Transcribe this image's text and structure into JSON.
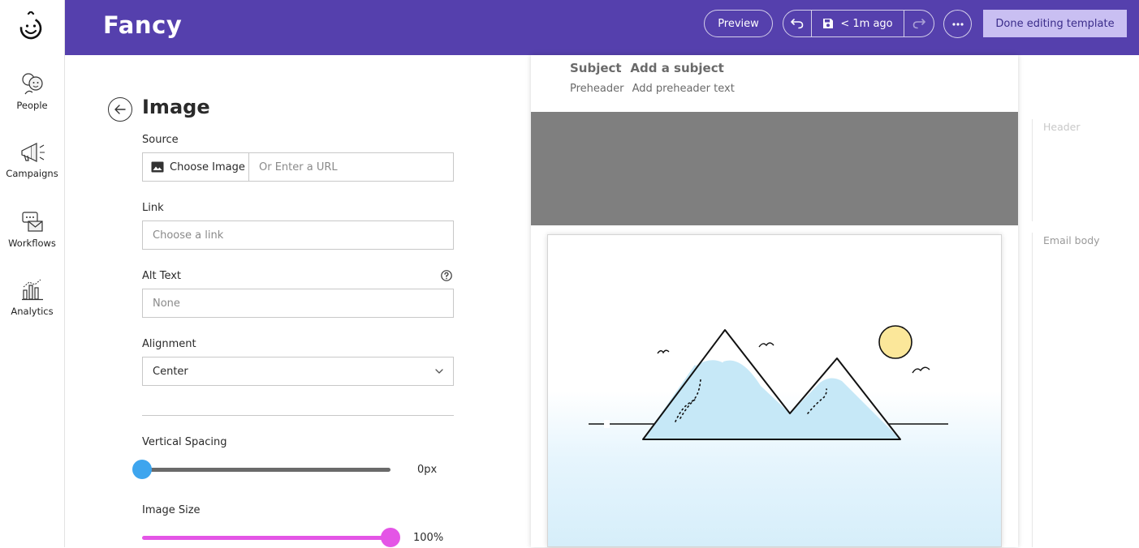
{
  "app": {
    "title": "Fancy"
  },
  "nav": [
    {
      "label": "People",
      "icon": "people-icon"
    },
    {
      "label": "Campaigns",
      "icon": "megaphone-icon"
    },
    {
      "label": "Workflows",
      "icon": "workflow-icon"
    },
    {
      "label": "Analytics",
      "icon": "analytics-icon"
    }
  ],
  "toolbar": {
    "preview_label": "Preview",
    "save_status": "< 1m ago",
    "done_label": "Done editing template"
  },
  "panel": {
    "title": "Image",
    "source_label": "Source",
    "choose_image_label": "Choose Image",
    "url_placeholder": "Or Enter a URL",
    "link_label": "Link",
    "link_placeholder": "Choose a link",
    "alt_label": "Alt Text",
    "alt_placeholder": "None",
    "alignment_label": "Alignment",
    "alignment_value": "Center",
    "vertical_spacing_label": "Vertical Spacing",
    "vertical_spacing_value": "0px",
    "vertical_spacing_fraction": 0,
    "image_size_label": "Image Size",
    "image_size_value": "100%",
    "image_size_fraction": 1
  },
  "email": {
    "subject_label": "Subject",
    "subject_placeholder": "Add a subject",
    "preheader_label": "Preheader",
    "preheader_placeholder": "Add preheader text"
  },
  "sections": {
    "header_label": "Header",
    "body_label": "Email body"
  },
  "colors": {
    "brand": "#5540ad",
    "done_button": "#c9bff2",
    "slider_spacing": "#3ea5ee",
    "slider_size": "#e455e6"
  }
}
